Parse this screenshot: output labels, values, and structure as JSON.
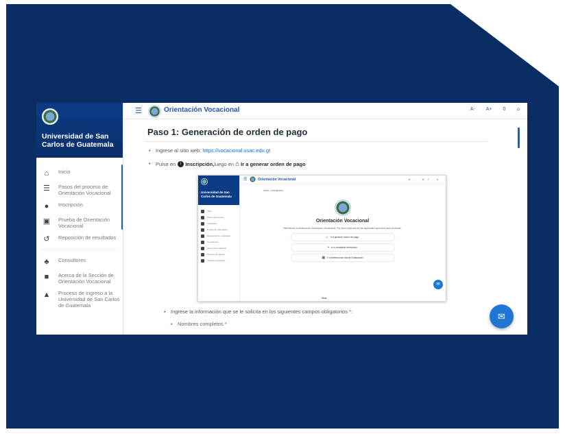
{
  "colors": {
    "background": "#0a2d63",
    "accent": "#2355a8",
    "fab": "#1f77d4"
  },
  "sidebar": {
    "title": "Universidad de San Carlos de Guatemala",
    "items": [
      {
        "icon": "home-icon",
        "label": "Inicio"
      },
      {
        "icon": "list-icon",
        "label": "Pasos del proceso de Orientación Vocacional"
      },
      {
        "icon": "info-icon",
        "label": "Inscripción"
      },
      {
        "icon": "clipboard-icon",
        "label": "Prueba de Orientación Vocacional"
      },
      {
        "icon": "history-icon",
        "label": "Reposición de resultados"
      },
      {
        "icon": "group-icon",
        "label": "Consultores"
      },
      {
        "icon": "book-icon",
        "label": "Acerca de la Sección de Orientación Vocacional"
      },
      {
        "icon": "graduation-cap-icon",
        "label": "Proceso de Ingreso a la Universidad de San Carlos de Guatemala"
      }
    ]
  },
  "topbar": {
    "title": "Orientación Vocacional",
    "font_decrease": "A-",
    "font_increase": "A+",
    "reset": "0",
    "search_icon": "search-icon"
  },
  "content": {
    "heading": "Paso 1: Generación de orden de pago",
    "bullet1_prefix": "Ingrese al sitio web: ",
    "bullet1_link": "https://vocacional.usac.edu.gt",
    "bullet2_prefix": "Pulse en",
    "bullet2_strong1": "Inscripción,",
    "bullet2_mid": " luego en",
    "bullet2_strong2": "Ir a generar orden de pago",
    "bullet3": "Ingrese la información que se le solicita en los siguientes campos obligatorios ",
    "bullet3_req": "*:",
    "sub1": "Nombres completos ",
    "sub1_req": "*"
  },
  "inner": {
    "sidebar_title": "Universidad de San Carlos de Guatemala",
    "topbar_title": "Orientación Vocacional",
    "topbar_actions": "A- A+ 0",
    "breadcrumb": "Inicio > Inscripción",
    "heading": "Orientación Vocacional",
    "paragraph": "Bienvenido al sistema de Orientación Vocacional. Por favor elija una de las siguientes opciones para continuar.",
    "buttons": [
      {
        "icon": "bank-icon",
        "label": "Ir a generar orden de pago"
      },
      {
        "icon": "document-icon",
        "label": "Ir a completar formulario"
      },
      {
        "icon": "calendar-icon",
        "label": "Ir a seleccionar día de Evaluación"
      }
    ],
    "more": "Más",
    "nav_items": [
      "Inicio",
      "Pasos del proceso",
      "Inscripción",
      "Prueba de Orientación",
      "Reposición de resultados",
      "Consultores",
      "Acerca de la Sección",
      "Proceso de Ingreso",
      "Fechas importantes"
    ]
  }
}
